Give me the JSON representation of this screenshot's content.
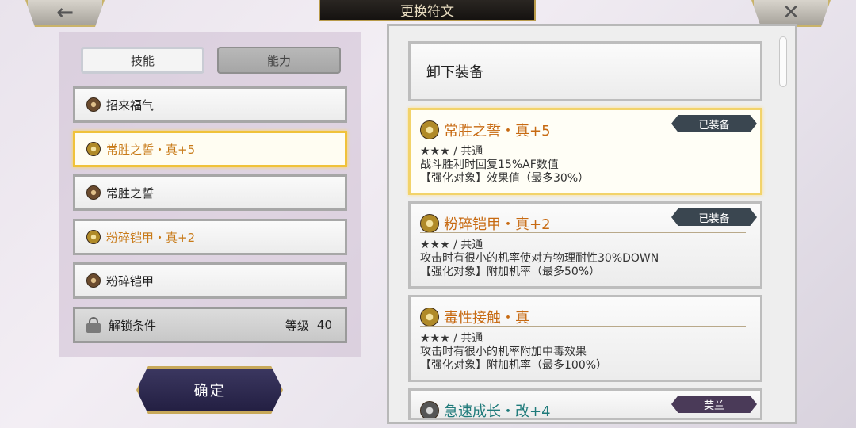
{
  "title": "更换符文",
  "back_icon": "arrow-left-icon",
  "close_icon": "close-icon",
  "tabs": [
    {
      "label": "技能",
      "active": true
    },
    {
      "label": "能力",
      "active": false
    }
  ],
  "rune_list": [
    {
      "name": "招来福气",
      "color": "#222222"
    },
    {
      "name": "常胜之誓・真+5",
      "color": "#c87a18",
      "selected": true
    },
    {
      "name": "常胜之誓",
      "color": "#222222"
    },
    {
      "name": "粉碎铠甲・真+2",
      "color": "#c87a18"
    },
    {
      "name": "粉碎铠甲",
      "color": "#222222"
    }
  ],
  "unlock": {
    "label": "解锁条件",
    "level_label": "等级",
    "level_value": "40"
  },
  "confirm_label": "确定",
  "unequip_label": "卸下装备",
  "cards": [
    {
      "title": "常胜之誓・真+5",
      "badge": "已装备",
      "rarity": "★★★ / 共通",
      "desc": "战斗胜利时回复15%AF数值",
      "enhance": "【强化对象】效果值（最多30%）"
    },
    {
      "title": "粉碎铠甲・真+2",
      "badge": "已装备",
      "rarity": "★★★ / 共通",
      "desc": "攻击时有很小的机率使对方物理耐性30%DOWN",
      "enhance": "【强化对象】附加机率（最多50%）"
    },
    {
      "title": "毒性接触・真",
      "badge": "",
      "rarity": "★★★ / 共通",
      "desc": "攻击时有很小的机率附加中毒效果",
      "enhance": "【强化对象】附加机率（最多100%）"
    },
    {
      "title": "急速成长・改+4",
      "badge": "芙兰",
      "rarity": "",
      "desc": "",
      "enhance": ""
    }
  ]
}
